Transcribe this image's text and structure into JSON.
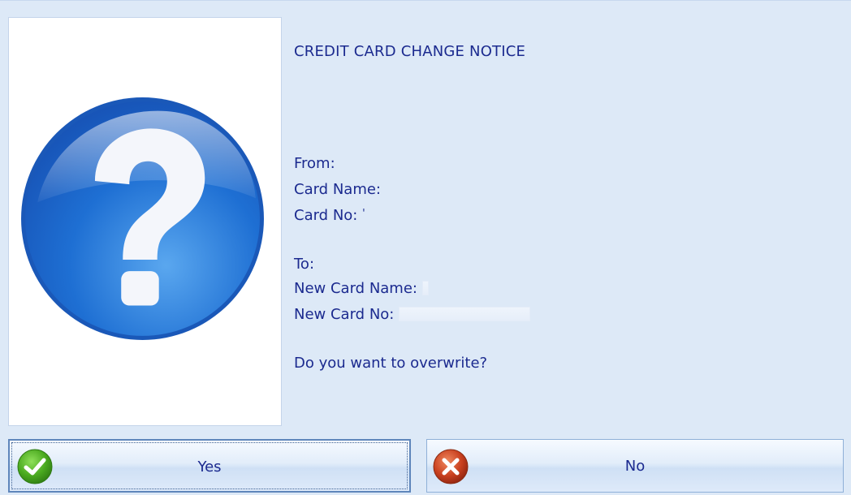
{
  "dialog": {
    "icon": "question-icon",
    "title": "CREDIT CARD CHANGE NOTICE",
    "from_label": "From:",
    "card_name_label": "Card Name:",
    "card_name_value": "",
    "card_no_label": "Card No:",
    "card_no_value": "'",
    "to_label": "To:",
    "new_card_name_label": "New Card Name:",
    "new_card_name_value": "",
    "new_card_no_label": "New Card No:",
    "new_card_no_value": "",
    "question": "Do you want to overwrite?"
  },
  "buttons": {
    "yes_label": "Yes",
    "yes_icon": "check-icon",
    "no_label": "No",
    "no_icon": "close-icon"
  },
  "colors": {
    "text": "#1b2a8f",
    "background": "#dde9f7",
    "icon_blue": "#1f6fd1",
    "check_green": "#4aa91f",
    "close_red": "#c9401f"
  }
}
